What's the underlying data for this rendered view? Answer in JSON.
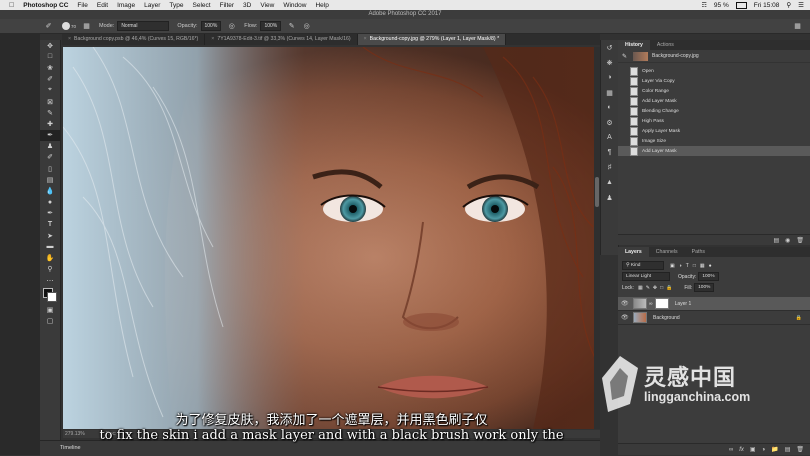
{
  "menubar": {
    "apple": "",
    "app": "Photoshop CC",
    "items": [
      "File",
      "Edit",
      "Image",
      "Layer",
      "Type",
      "Select",
      "Filter",
      "3D",
      "View",
      "Window",
      "Help"
    ],
    "battery": "95 %",
    "time": "Fri 15:08"
  },
  "app_title": "Adobe Photoshop CC 2017",
  "options": {
    "brush_size": "70",
    "mode_label": "Mode:",
    "mode_value": "Normal",
    "opacity_label": "Opacity:",
    "opacity_value": "100%",
    "flow_label": "Flow:",
    "flow_value": "100%"
  },
  "tabs": [
    {
      "label": "Background copy.psb @ 46,4% (Curves 15, RGB/16*)",
      "active": false
    },
    {
      "label": "7Y1A9378-Edit-3.tif @ 33,3% (Curves 14, Layer Mask/16)",
      "active": false
    },
    {
      "label": "Background-copy.jpg @ 279% (Layer 1, Layer Mask/8) *",
      "active": true
    }
  ],
  "status": {
    "zoom": "279.13%",
    "doc": "Doc:"
  },
  "timeline_label": "Timeline",
  "history": {
    "tabs": [
      "History",
      "Actions"
    ],
    "snapshot": "Background-copy.jpg",
    "items": [
      "Open",
      "Layer Via Copy",
      "Color Range",
      "Add Layer Mask",
      "Blending Change",
      "High Pass",
      "Apply Layer Mask",
      "Image Size",
      "Add Layer Mask"
    ],
    "selected_index": 8
  },
  "layers": {
    "tabs": [
      "Layers",
      "Channels",
      "Paths"
    ],
    "filter_value": "Kind",
    "blend_mode": "Linear Light",
    "opacity_label": "Opacity:",
    "opacity_value": "100%",
    "lock_label": "Lock:",
    "fill_label": "Fill:",
    "fill_value": "100%",
    "items": [
      {
        "name": "Layer 1",
        "selected": true
      },
      {
        "name": "Background",
        "selected": false
      }
    ]
  },
  "subtitles": {
    "chinese": "为了修复皮肤，我添加了一个遮罩层，并用黑色刷子仅",
    "english": "to fix the skin i add a mask layer and with a black brush work only the"
  },
  "watermark": {
    "brand": "灵感中国",
    "url": "lingganchina.com"
  }
}
